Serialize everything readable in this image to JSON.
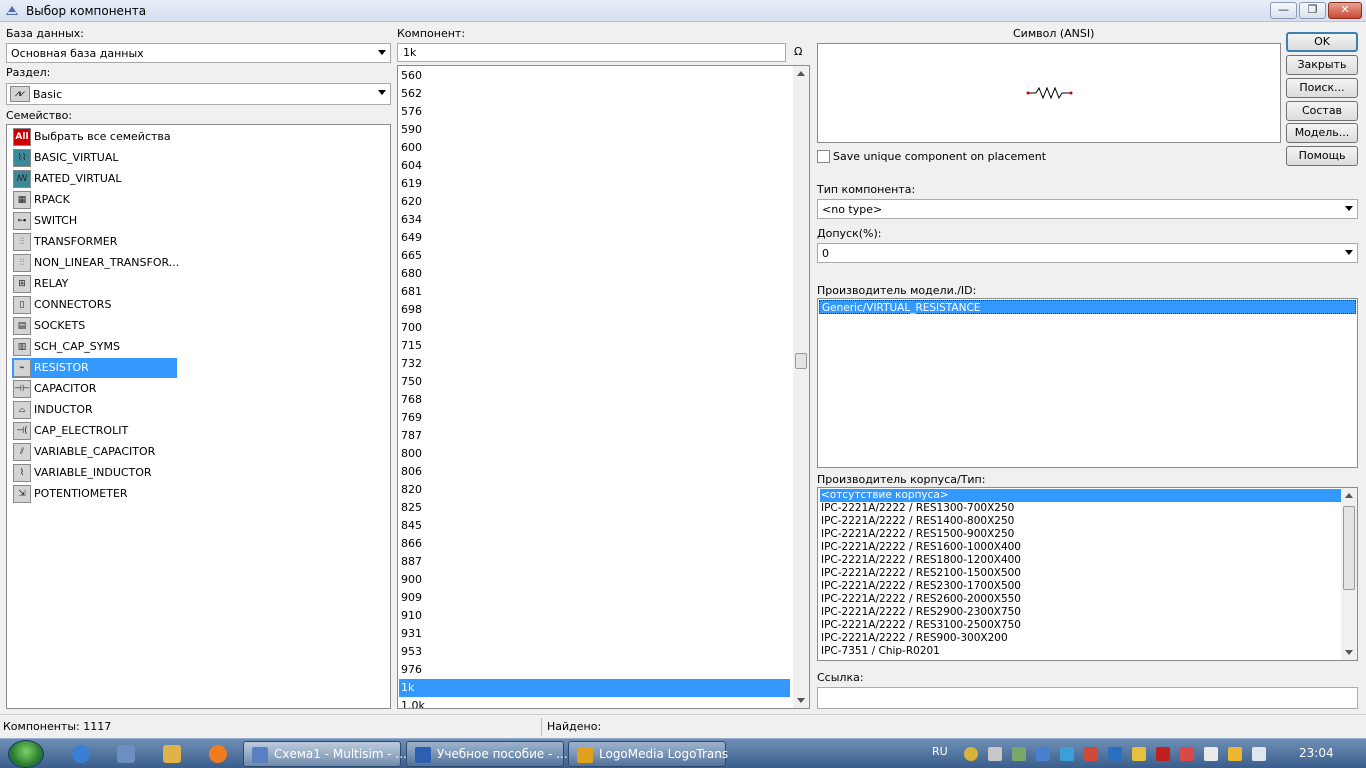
{
  "window": {
    "title": "Выбор компонента"
  },
  "database": {
    "label": "База данных:",
    "value": "Основная база данных"
  },
  "group": {
    "label": "Раздел:",
    "value": "Basic"
  },
  "family": {
    "label": "Семейство:",
    "items": [
      {
        "label": "Выбрать все семейства",
        "icon": "all-icon"
      },
      {
        "label": "BASIC_VIRTUAL",
        "icon": "basic-virtual-icon"
      },
      {
        "label": "RATED_VIRTUAL",
        "icon": "rated-virtual-icon"
      },
      {
        "label": "RPACK",
        "icon": "rpack-icon"
      },
      {
        "label": "SWITCH",
        "icon": "switch-icon"
      },
      {
        "label": "TRANSFORMER",
        "icon": "transformer-icon"
      },
      {
        "label": "NON_LINEAR_TRANSFOR...",
        "icon": "nonlinear-transformer-icon"
      },
      {
        "label": "RELAY",
        "icon": "relay-icon"
      },
      {
        "label": "CONNECTORS",
        "icon": "connectors-icon"
      },
      {
        "label": "SOCKETS",
        "icon": "sockets-icon"
      },
      {
        "label": "SCH_CAP_SYMS",
        "icon": "sch-cap-syms-icon"
      },
      {
        "label": "RESISTOR",
        "icon": "resistor-icon",
        "selected": true
      },
      {
        "label": "CAPACITOR",
        "icon": "capacitor-icon"
      },
      {
        "label": "INDUCTOR",
        "icon": "inductor-icon"
      },
      {
        "label": "CAP_ELECTROLIT",
        "icon": "cap-electrolit-icon"
      },
      {
        "label": "VARIABLE_CAPACITOR",
        "icon": "variable-capacitor-icon"
      },
      {
        "label": "VARIABLE_INDUCTOR",
        "icon": "variable-inductor-icon"
      },
      {
        "label": "POTENTIOMETER",
        "icon": "potentiometer-icon"
      }
    ]
  },
  "component": {
    "label": "Компонент:",
    "search_value": "1k",
    "filter_icon": "omega-icon",
    "filter_glyph": "Ω",
    "items": [
      "560",
      "562",
      "576",
      "590",
      "600",
      "604",
      "619",
      "620",
      "634",
      "649",
      "665",
      "680",
      "681",
      "698",
      "700",
      "715",
      "732",
      "750",
      "768",
      "769",
      "787",
      "800",
      "806",
      "820",
      "825",
      "845",
      "866",
      "887",
      "900",
      "909",
      "910",
      "931",
      "953",
      "976",
      "1k",
      "1.0k"
    ],
    "selected": "1k"
  },
  "symbol": {
    "label": "Символ (ANSI)"
  },
  "save_unique": {
    "label": "Save unique component on placement",
    "checked": false
  },
  "component_type": {
    "label": "Тип компонента:",
    "value": "<no type>"
  },
  "tolerance": {
    "label": "Допуск(%):",
    "value": "0"
  },
  "model_manufacturer": {
    "label": "Производитель модели./ID:",
    "items": [
      "Generic/VIRTUAL_RESISTANCE"
    ]
  },
  "footprint": {
    "label": "Производитель корпуса/Тип:",
    "items": [
      "<отсутствие корпуса>",
      "IPC-2221A/2222 / RES1300-700X250",
      "IPC-2221A/2222 / RES1400-800X250",
      "IPC-2221A/2222 / RES1500-900X250",
      "IPC-2221A/2222 / RES1600-1000X400",
      "IPC-2221A/2222 / RES1800-1200X400",
      "IPC-2221A/2222 / RES2100-1500X500",
      "IPC-2221A/2222 / RES2300-1700X500",
      "IPC-2221A/2222 / RES2600-2000X550",
      "IPC-2221A/2222 / RES2900-2300X750",
      "IPC-2221A/2222 / RES3100-2500X750",
      "IPC-2221A/2222 / RES900-300X200",
      "IPC-7351 / Chip-R0201"
    ]
  },
  "hyperlink": {
    "label": "Ссылка:",
    "value": ""
  },
  "buttons": {
    "ok": "OK",
    "close": "Закрыть",
    "search": "Поиск...",
    "detail": "Состав",
    "model": "Модель...",
    "help": "Помощь"
  },
  "status": {
    "components": "Компоненты: 1117",
    "found": "Найдено:"
  },
  "taskbar": {
    "tasks": [
      {
        "label": "Схема1 - Multisim - ...",
        "icon": "multisim-icon",
        "active": true
      },
      {
        "label": "Учебное пособие - ...",
        "icon": "word-icon"
      },
      {
        "label": "LogoMedia LogoTrans",
        "icon": "logotrans-icon"
      }
    ],
    "language": "RU",
    "clock": "23:04"
  },
  "colors": {
    "selection": "#3399ff",
    "taskbar": "#3a5e8c"
  }
}
